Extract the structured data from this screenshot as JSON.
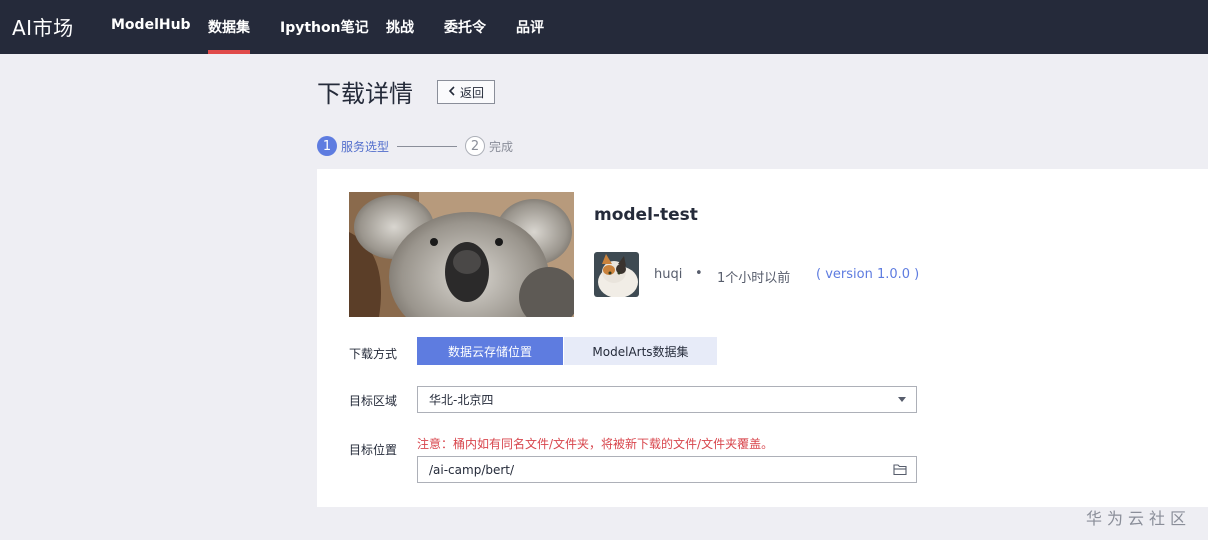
{
  "app": {
    "brand": "AI市场"
  },
  "nav": {
    "items": [
      {
        "label": "ModelHub"
      },
      {
        "label": "数据集"
      },
      {
        "label": "Ipython笔记"
      },
      {
        "label": "挑战"
      },
      {
        "label": "委托令"
      },
      {
        "label": "品评"
      }
    ],
    "active": "数据集"
  },
  "header": {
    "title": "下载详情",
    "back_label": "返回"
  },
  "steps": [
    {
      "number": "1",
      "label": "服务选型",
      "state": "active"
    },
    {
      "number": "2",
      "label": "完成",
      "state": "pending"
    }
  ],
  "dataset": {
    "name": "model-test",
    "author": "huqi",
    "separator": "•",
    "time": "1个小时以前",
    "version": "( version 1.0.0 )"
  },
  "form": {
    "download_method_label": "下载方式",
    "method_options": [
      "数据云存储位置",
      "ModelArts数据集"
    ],
    "method_selected": "数据云存储位置",
    "region_label": "目标区域",
    "region_value": "华北-北京四",
    "location_label": "目标位置",
    "location_warning": "注意：桶内如有同名文件/文件夹，将被新下载的文件/文件夹覆盖。",
    "location_value": "/ai-camp/bert/"
  },
  "watermark": "华为云社区",
  "colors": {
    "topbar": "#252a3a",
    "accent": "#5e7ce0",
    "nav_underline": "#e04a4a",
    "warning": "#d8464d",
    "page_bg": "#eeeef3"
  },
  "icons": [
    "chevron-left-icon",
    "dropdown-arrow-icon",
    "folder-icon"
  ]
}
